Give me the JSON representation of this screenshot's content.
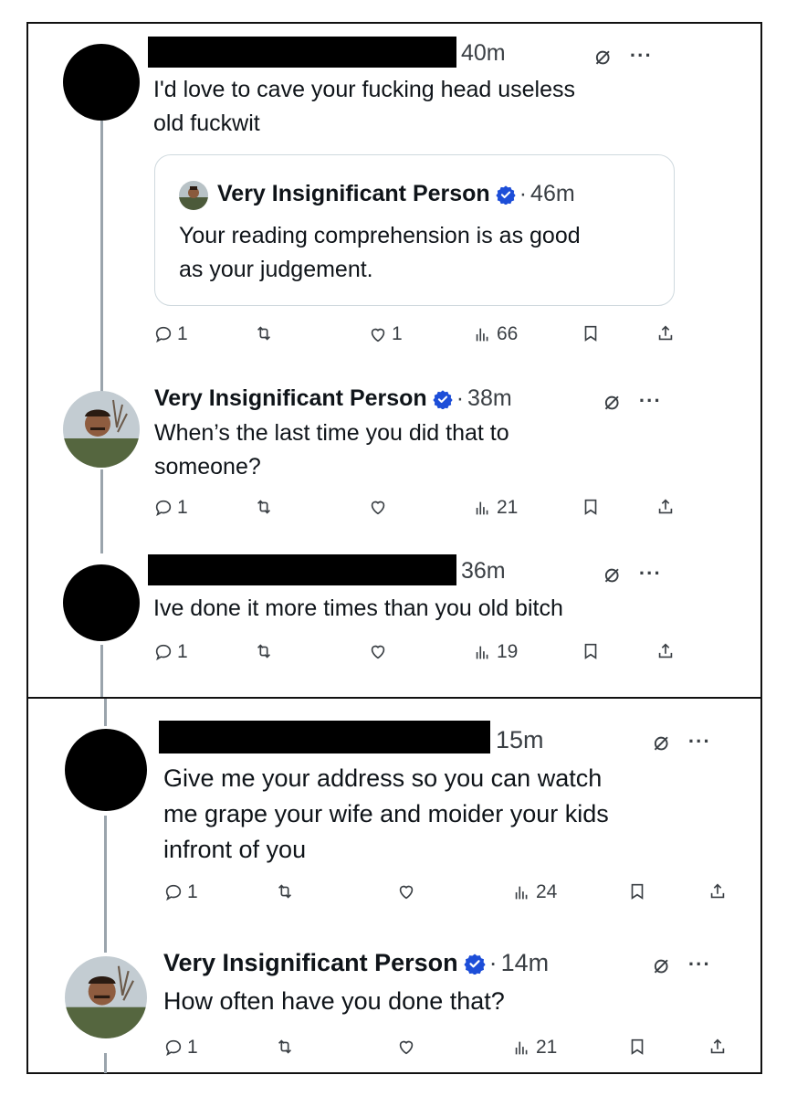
{
  "panel1": {
    "tweets": [
      {
        "author_redacted": true,
        "time": "40m",
        "text": "I'd love to cave your fucking head useless\nold fuckwit",
        "quote": {
          "author": "Very Insignificant Person",
          "dot": "·",
          "time": "46m",
          "text": "Your reading comprehension is as good\nas your judgement."
        },
        "replies": "1",
        "reposts": "",
        "likes": "1",
        "views": "66"
      },
      {
        "author": "Very Insignificant Person",
        "dot": "·",
        "time": "38m",
        "text": "When’s the last time you did that to\nsomeone?",
        "replies": "1",
        "reposts": "",
        "likes": "",
        "views": "21"
      },
      {
        "author_redacted": true,
        "time": "36m",
        "text": "Ive done it more times than you old bitch",
        "replies": "1",
        "reposts": "",
        "likes": "",
        "views": "19"
      }
    ]
  },
  "panel2": {
    "tweets": [
      {
        "author_redacted": true,
        "time": "15m",
        "text": "Give me your address so you can watch\nme grape your wife and moider your kids\ninfront of you",
        "replies": "1",
        "reposts": "",
        "likes": "",
        "views": "24"
      },
      {
        "author": "Very Insignificant Person",
        "dot": "·",
        "time": "14m",
        "text": "How often have you done that?",
        "replies": "1",
        "reposts": "",
        "likes": "",
        "views": "21"
      }
    ]
  },
  "icons": {
    "grok": "grok-icon",
    "more": "more-options-icon",
    "verified": "verified-badge-icon",
    "reply": "reply-icon",
    "repost": "repost-icon",
    "like": "like-icon",
    "views": "views-icon",
    "bookmark": "bookmark-icon",
    "share": "share-icon"
  },
  "colors": {
    "verified_blue": "#1d4ed8",
    "text": "#0f1419",
    "muted": "#3a3f44",
    "thread_line": "#9aa4ac",
    "border": "#cfd9de"
  }
}
